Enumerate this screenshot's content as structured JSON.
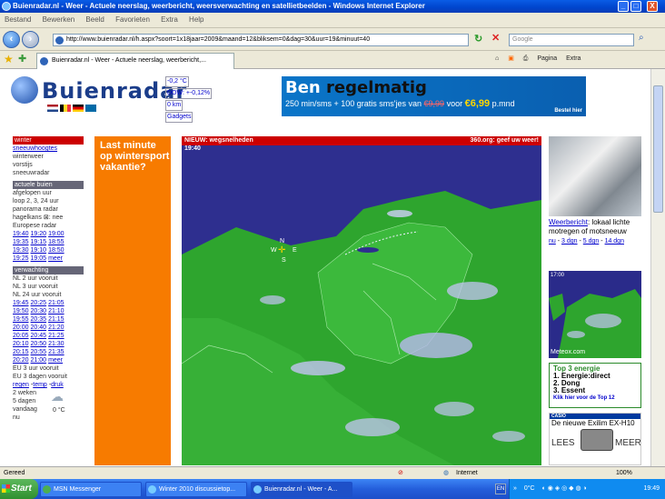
{
  "window": {
    "title": "Buienradar.nl - Weer - Actuele neerslag, weerbericht, weersverwachting en satellietbeelden - Windows Internet Explorer",
    "minimize": "_",
    "maximize": "□",
    "close": "X"
  },
  "menu": [
    "Bestand",
    "Bewerken",
    "Beeld",
    "Favorieten",
    "Extra",
    "Help"
  ],
  "address": {
    "url": "http://www.buienradar.nl/h.aspx?soort=1x18jaar=2009&maand=12&bliksem=0&dag=30&uur=19&minuut=40",
    "search_placeholder": "Google"
  },
  "tab": {
    "title": "Buienradar.nl - Weer - Actuele neerslag, weerbericht,...",
    "tools": [
      "Pagina",
      "Extra"
    ]
  },
  "logo": {
    "text": "Buienradar"
  },
  "info_links": [
    "-0,2 °C",
    "DOW: +-0,12%",
    "0 km",
    "Gadgets"
  ],
  "banner": {
    "line1a": "Ben ",
    "line1b": "regelmatig",
    "line2_pre": "250 min/sms + 100 gratis sms'jes van ",
    "line2_old": "€9,99",
    "line2_mid": " voor ",
    "line2_new": "€6,99",
    "line2_post": " p.mnd",
    "cta": "Bestel hier"
  },
  "sidebar": {
    "winter": {
      "head": "winter",
      "items": [
        "sneeuwhoogtes",
        "winterweer",
        "vorstijs",
        "sneeuwradar"
      ]
    },
    "actueel": {
      "head": "actuele buien",
      "items": [
        "afgelopen uur",
        "loop 2, 3, 24 uur",
        "panorama radar",
        "hagelkans ⊠: nee",
        "Europese radar"
      ],
      "times": [
        [
          "19:40",
          "19:20",
          "19:00"
        ],
        [
          "19:35",
          "19:15",
          "18:55"
        ],
        [
          "19:30",
          "19:10",
          "18:50"
        ],
        [
          "19:25",
          "19:05",
          "meer"
        ]
      ]
    },
    "verwachting": {
      "head": "verwachting",
      "items": [
        "NL 2 uur vooruit",
        "NL 3 uur vooruit",
        "NL 24 uur vooruit"
      ],
      "times": [
        [
          "19:45",
          "20:25",
          "21:05"
        ],
        [
          "19:50",
          "20:30",
          "21:10"
        ],
        [
          "19:55",
          "20:35",
          "21:15"
        ],
        [
          "20:00",
          "20:40",
          "21:20"
        ],
        [
          "20:05",
          "20:45",
          "21:25"
        ],
        [
          "20:10",
          "20:50",
          "21:30"
        ],
        [
          "20:15",
          "20:55",
          "21:35"
        ],
        [
          "20:20",
          "21:00",
          "meer"
        ]
      ],
      "items2": [
        "EU 3 uur vooruit",
        "EU 3 dagen vooruit"
      ],
      "links": [
        "regen",
        "temp",
        "druk"
      ],
      "items3": [
        "2 weken",
        "5 dagen",
        "vandaag",
        "nu"
      ],
      "temp": "0 °C"
    }
  },
  "promo": {
    "text": "Last minute op wintersport vakantie?"
  },
  "map": {
    "header_left": "NIEUW: wegsnelheden",
    "header_right": "360.org: geef uw weer!",
    "time": "19:40",
    "compass": {
      "n": "N",
      "s": "S",
      "e": "E",
      "w": "W"
    }
  },
  "right_col": {
    "weerbericht_link": "Weerbericht",
    "weerbericht_text": ": lokaal lichte motregen of motsneeuw",
    "weerbericht_links": [
      "nu",
      "3 dgn",
      "5 dgn",
      "14 dgn"
    ],
    "sat_time": "17:00",
    "sat_label": "Meteox.com",
    "top3": {
      "head": "Top 3 energie",
      "items": [
        "1. Energie:direct",
        "2. Dong",
        "3. Essent"
      ],
      "cta": "Klik hier voor de Top 12"
    },
    "casio": {
      "brand": "CASIO",
      "text": "De nieuwe Exilim EX-H10",
      "lees": "LEES",
      "meer": "MEER"
    }
  },
  "status": {
    "left": "Gereed",
    "zone": "Internet",
    "zoom": "100%"
  },
  "taskbar": {
    "start": "Start",
    "tasks": [
      "MSN Messenger",
      "Winter 2010 discussietop...",
      "Buienradar.nl - Weer - A..."
    ],
    "lang": "EN",
    "temp": "0°C",
    "clock": "19:49"
  }
}
